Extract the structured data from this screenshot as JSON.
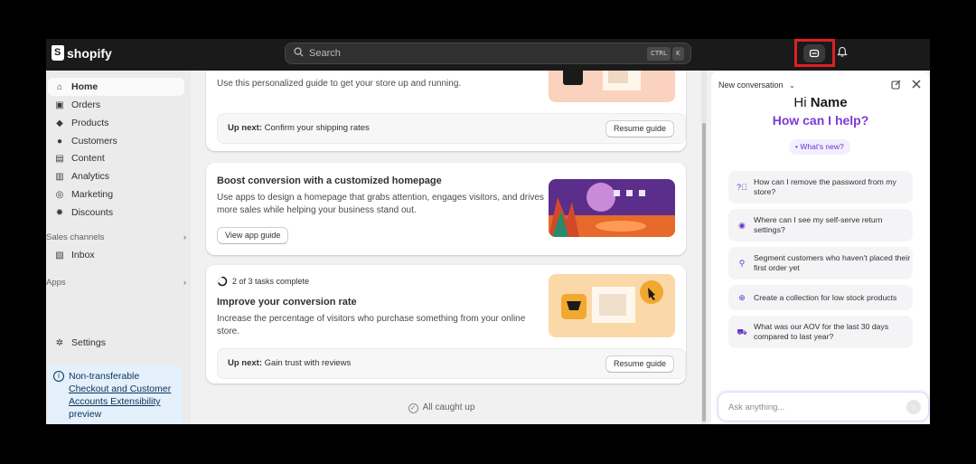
{
  "topbar": {
    "logo_text": "shopify",
    "search_placeholder": "Search",
    "kbd_ctrl": "CTRL",
    "kbd_k": "K",
    "sidekick_icon": "sidekick-icon",
    "bell_icon": "bell-icon"
  },
  "sidebar": {
    "items": [
      {
        "label": "Home",
        "icon": "home-icon",
        "active": true
      },
      {
        "label": "Orders",
        "icon": "orders-icon"
      },
      {
        "label": "Products",
        "icon": "tag-icon"
      },
      {
        "label": "Customers",
        "icon": "person-icon"
      },
      {
        "label": "Content",
        "icon": "content-icon"
      },
      {
        "label": "Analytics",
        "icon": "chart-icon"
      },
      {
        "label": "Marketing",
        "icon": "target-icon"
      },
      {
        "label": "Discounts",
        "icon": "discount-icon"
      }
    ],
    "sales_channels_label": "Sales channels",
    "inbox_label": "Inbox",
    "apps_label": "Apps",
    "settings_label": "Settings",
    "notice": {
      "line1": "Non-transferable",
      "link": "Checkout and Customer Accounts Extensibility",
      "line3": "preview"
    }
  },
  "main": {
    "card1": {
      "desc": "Use this personalized guide to get your store up and running.",
      "upnext_label": "Up next:",
      "upnext_text": "Confirm your shipping rates",
      "button": "Resume guide"
    },
    "card2": {
      "title": "Boost conversion with a customized homepage",
      "desc": "Use apps to design a homepage that grabs attention, engages visitors, and drives more sales while helping your business stand out.",
      "button": "View app guide"
    },
    "card3": {
      "progress_text": "2 of 3 tasks complete",
      "progress_fraction": 0.667,
      "title": "Improve your conversion rate",
      "desc": "Increase the percentage of visitors who purchase something from your online store.",
      "upnext_label": "Up next:",
      "upnext_text": "Gain trust with reviews",
      "button": "Resume guide"
    },
    "caught_up": "All caught up"
  },
  "panel": {
    "header": "New conversation",
    "greeting": "Hi",
    "name": "Name",
    "help": "How can I help?",
    "whats_new": "What's new?",
    "suggestions": [
      {
        "text": "How can I remove the password from my store?",
        "icon": "question-icon"
      },
      {
        "text": "Where can I see my self-serve return settings?",
        "icon": "compass-icon"
      },
      {
        "text": "Segment customers who haven't placed their first order yet",
        "icon": "person-icon"
      },
      {
        "text": "Create a collection for low stock products",
        "icon": "plus-circle-icon"
      },
      {
        "text": "What was our AOV for the last 30 days compared to last year?",
        "icon": "cart-icon"
      }
    ],
    "ask_placeholder": "Ask anything..."
  },
  "colors": {
    "accent_purple": "#7c3ad6",
    "highlight_red": "#e02020",
    "topbar": "#1a1a1a"
  }
}
